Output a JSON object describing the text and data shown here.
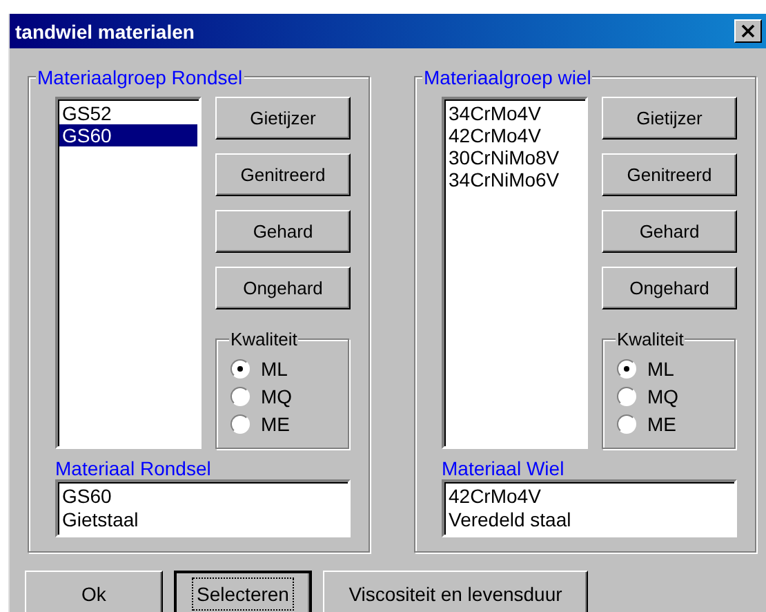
{
  "window": {
    "title": "tandwiel materialen"
  },
  "groups": [
    {
      "title": "Materiaalgroep Rondsel",
      "items": [
        {
          "label": "GS52",
          "selected": false
        },
        {
          "label": "GS60",
          "selected": true
        }
      ],
      "buttons": [
        "Gietijzer",
        "Genitreerd",
        "Gehard",
        "Ongehard"
      ],
      "quality": {
        "title": "Kwaliteit",
        "options": [
          {
            "label": "ML",
            "selected": true
          },
          {
            "label": "MQ",
            "selected": false
          },
          {
            "label": "ME",
            "selected": false
          }
        ]
      },
      "material_label": "Materiaal Rondsel",
      "material_lines": [
        "GS60",
        "Gietstaal"
      ]
    },
    {
      "title": "Materiaalgroep wiel",
      "items": [
        {
          "label": "34CrMo4V",
          "selected": false
        },
        {
          "label": "42CrMo4V",
          "selected": false
        },
        {
          "label": "30CrNiMo8V",
          "selected": false
        },
        {
          "label": "34CrNiMo6V",
          "selected": false
        }
      ],
      "buttons": [
        "Gietijzer",
        "Genitreerd",
        "Gehard",
        "Ongehard"
      ],
      "quality": {
        "title": "Kwaliteit",
        "options": [
          {
            "label": "ML",
            "selected": true
          },
          {
            "label": "MQ",
            "selected": false
          },
          {
            "label": "ME",
            "selected": false
          }
        ]
      },
      "material_label": "Materiaal Wiel",
      "material_lines": [
        "42CrMo4V",
        "Veredeld staal"
      ]
    }
  ],
  "footer_buttons": [
    {
      "label": "Ok",
      "focused": false
    },
    {
      "label": "Selecteren",
      "focused": true
    },
    {
      "label": "Viscositeit en levensduur",
      "focused": false
    }
  ]
}
